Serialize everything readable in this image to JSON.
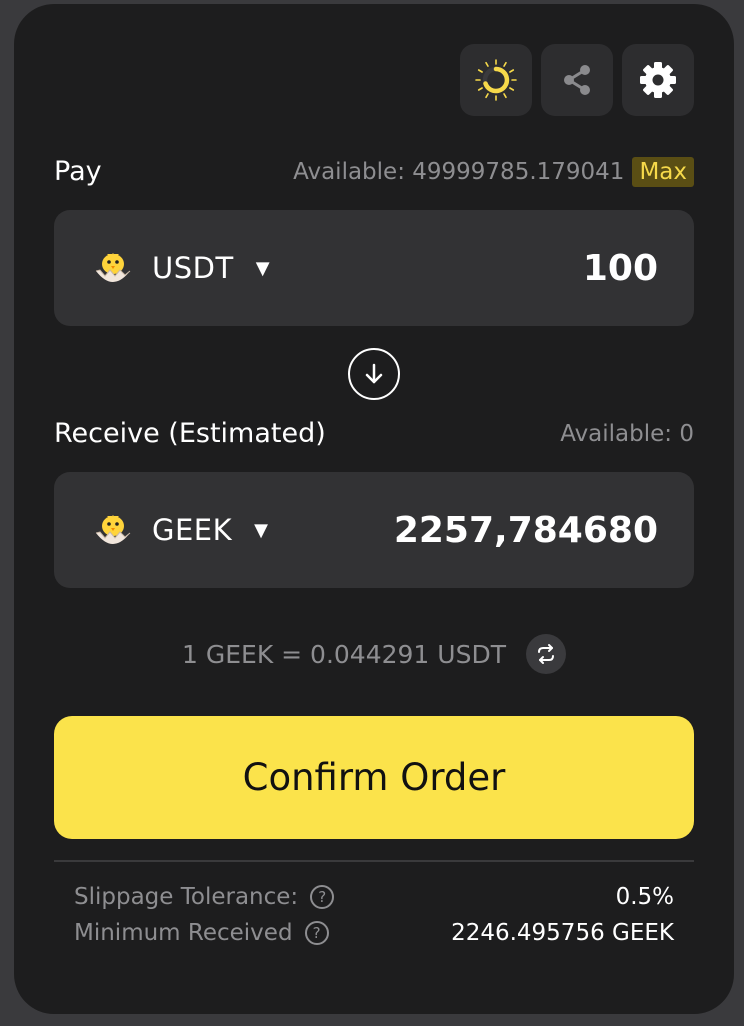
{
  "toolbar": {
    "icons": [
      "loading-ring-icon",
      "share-icon",
      "gear-icon"
    ]
  },
  "pay": {
    "label": "Pay",
    "available": "Available: 49999785.179041",
    "max_label": "Max",
    "token": "USDT",
    "amount": "100"
  },
  "receive": {
    "label": "Receive (Estimated)",
    "available": "Available: 0",
    "token": "GEEK",
    "amount": "2257,784680"
  },
  "rate": {
    "text": "1 GEEK = 0.044291 USDT"
  },
  "confirm": {
    "label": "Confirm Order"
  },
  "details": {
    "slippage_label": "Slippage Tolerance:",
    "slippage_value": "0.5%",
    "min_received_label": "Minimum Received",
    "min_received_value": "2246.495756 GEEK"
  },
  "colors": {
    "accent": "#fbe34b",
    "card_bg": "#1d1d1e",
    "field_bg": "#323234",
    "muted_text": "#8e8e91"
  }
}
